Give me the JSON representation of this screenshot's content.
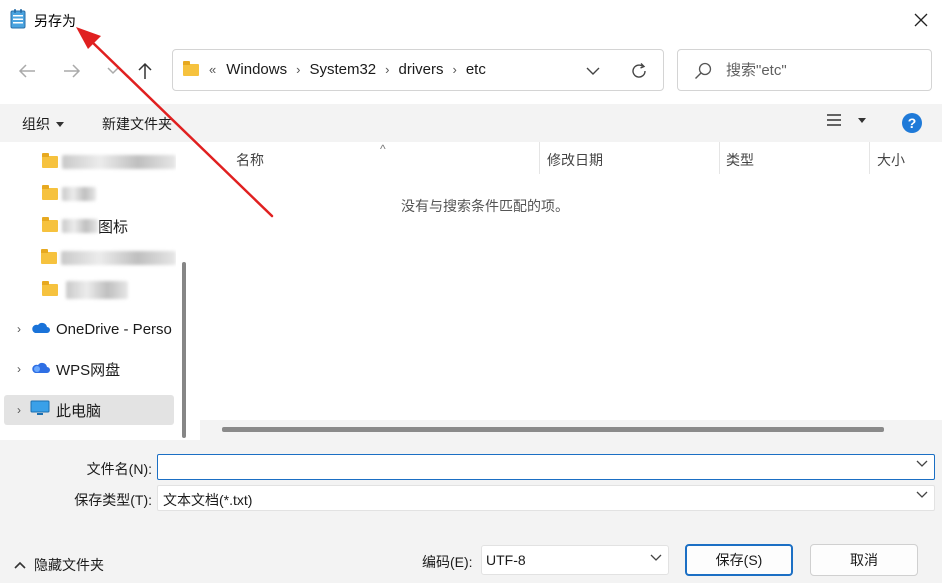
{
  "window": {
    "title": "另存为",
    "close_glyph": "✕"
  },
  "navigation": {
    "back_icon": "arrow-left-icon",
    "forward_icon": "arrow-right-icon",
    "recent_icon": "chevron-down-icon",
    "up_icon": "arrow-up-icon"
  },
  "address": {
    "prefix": "«",
    "crumbs": [
      "Windows",
      "System32",
      "drivers",
      "etc"
    ],
    "separator": "›"
  },
  "search": {
    "placeholder": "搜索\"etc\""
  },
  "toolbar": {
    "organize_label": "组织",
    "new_folder_label": "新建文件夹",
    "help_label": "?"
  },
  "nav_pane": {
    "items": [
      {
        "label": "",
        "blurred": true
      },
      {
        "label": "",
        "blurred": true
      },
      {
        "label": "图标",
        "blurred": true
      },
      {
        "label": "",
        "blurred": true
      },
      {
        "label": "",
        "blurred": true
      },
      {
        "label": "OneDrive - Perso",
        "icon": "onedrive-cloud-icon"
      },
      {
        "label": "WPS网盘",
        "icon": "wps-cloud-icon"
      },
      {
        "label": "此电脑",
        "icon": "monitor-icon",
        "selected": true
      }
    ]
  },
  "file_list": {
    "columns": [
      "名称",
      "修改日期",
      "类型",
      "大小"
    ],
    "empty_message": "没有与搜索条件匹配的项。"
  },
  "form": {
    "filename_label": "文件名(N):",
    "filename_value": "",
    "filetype_label": "保存类型(T):",
    "filetype_value": "文本文档(*.txt)",
    "hide_folders_label": "隐藏文件夹",
    "encoding_label": "编码(E):",
    "encoding_value": "UTF-8",
    "save_label": "保存(S)",
    "cancel_label": "取消"
  },
  "colors": {
    "accent": "#1b6fc4",
    "annotation_arrow": "#e02020",
    "folder": "#f6c23e"
  }
}
